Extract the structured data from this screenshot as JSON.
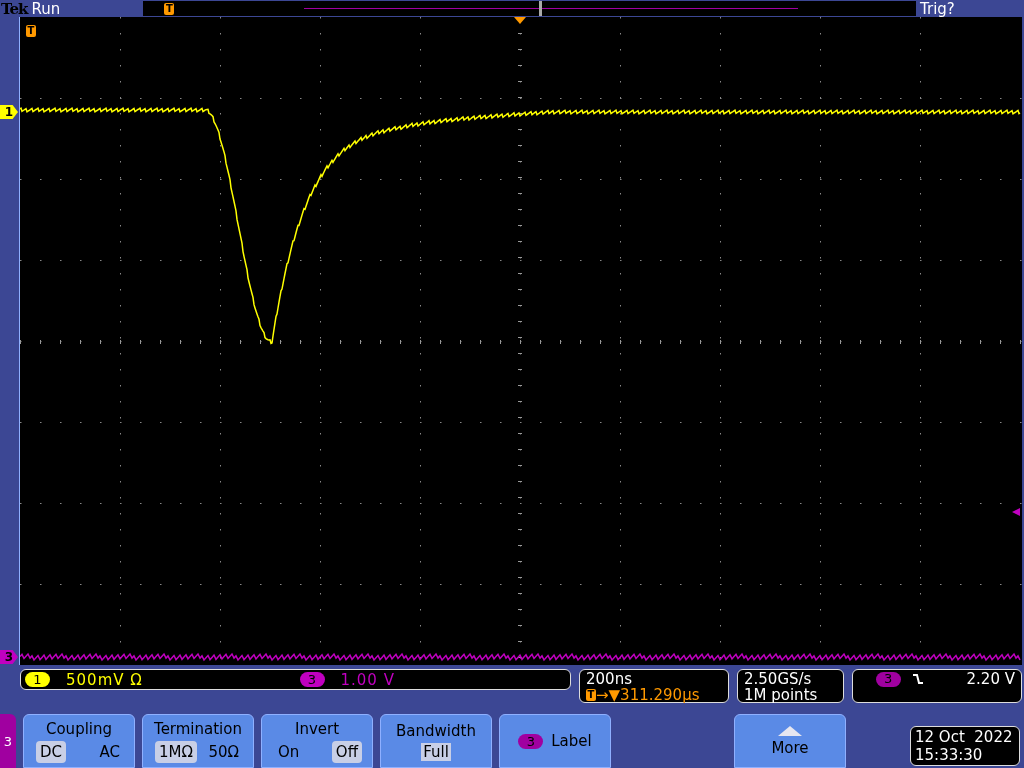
{
  "status": {
    "brand": "Tek",
    "state": "Run",
    "record_trigger_badge": "T",
    "trigger_status": "Trig?"
  },
  "screen": {
    "trigger_badge": "T",
    "channel_markers": [
      {
        "label": "1",
        "color": "#ffff00"
      },
      {
        "label": "3",
        "color": "#c000c0"
      }
    ]
  },
  "channel_readouts": [
    {
      "number": "1",
      "scale": "500mV",
      "termination": "Ω",
      "color": "#ffff00"
    },
    {
      "number": "3",
      "scale": "1.00 V",
      "color": "#c000c0"
    }
  ],
  "timebase": {
    "scale": "200ns",
    "position_badge": "T",
    "position": "→▼311.290µs"
  },
  "acquisition": {
    "sample_rate": "2.50GS/s",
    "record_length": "1M points"
  },
  "trigger": {
    "source": "3",
    "level": "2.20 V"
  },
  "channel_tab": "3",
  "menu": [
    {
      "kind": "toggle",
      "title": "Coupling",
      "options": [
        {
          "label": "DC",
          "selected": true
        },
        {
          "label": "AC",
          "selected": false
        }
      ]
    },
    {
      "kind": "toggle",
      "title": "Termination",
      "options": [
        {
          "label": "1MΩ",
          "selected": true
        },
        {
          "label": "50Ω",
          "selected": false
        }
      ]
    },
    {
      "kind": "toggle",
      "title": "Invert",
      "options": [
        {
          "label": "On",
          "selected": false
        },
        {
          "label": "Off",
          "selected": true
        }
      ]
    },
    {
      "kind": "value",
      "title": "Bandwidth",
      "value": "Full"
    },
    {
      "kind": "badge",
      "badge": "3",
      "title": "Label"
    }
  ],
  "more_button": "More",
  "date": "12 Oct  2022",
  "time": "15:33:30"
}
